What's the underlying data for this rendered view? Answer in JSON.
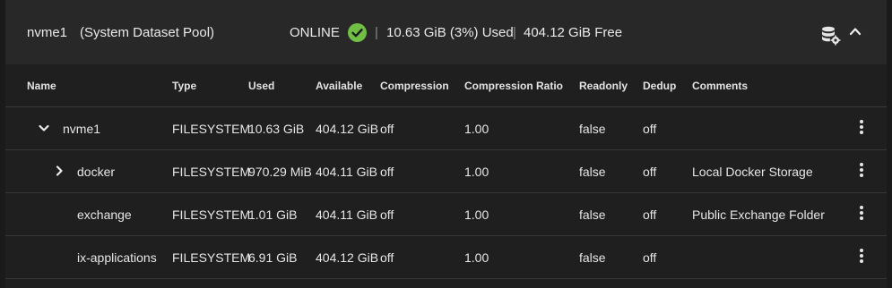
{
  "pool": {
    "name": "nvme1",
    "role": "(System Dataset Pool)",
    "status": "ONLINE",
    "used": "10.63 GiB (3%) Used",
    "free": "404.12 GiB Free",
    "separator": "|"
  },
  "icons": {
    "status": "check-circle-icon",
    "dataset_actions": "database-gear-icon",
    "collapse": "chevron-up-icon",
    "expanded": "chevron-down-icon",
    "collapsed": "chevron-right-icon",
    "row_menu": "more-vertical-icon"
  },
  "colors": {
    "status_ok": "#71bf44"
  },
  "columns": [
    "Name",
    "Type",
    "Used",
    "Available",
    "Compression",
    "Compression Ratio",
    "Readonly",
    "Dedup",
    "Comments"
  ],
  "rows": [
    {
      "name": "nvme1",
      "type": "FILESYSTEM",
      "used": "10.63 GiB",
      "available": "404.12 GiB",
      "compression": "off",
      "ratio": "1.00",
      "readonly": "false",
      "dedup": "off",
      "comments": "",
      "toggle": "expanded"
    },
    {
      "name": "docker",
      "type": "FILESYSTEM",
      "used": "970.29 MiB",
      "available": "404.11 GiB",
      "compression": "off",
      "ratio": "1.00",
      "readonly": "false",
      "dedup": "off",
      "comments": "Local Docker Storage",
      "toggle": "collapsed"
    },
    {
      "name": "exchange",
      "type": "FILESYSTEM",
      "used": "1.01 GiB",
      "available": "404.11 GiB",
      "compression": "off",
      "ratio": "1.00",
      "readonly": "false",
      "dedup": "off",
      "comments": "Public Exchange Folder",
      "toggle": "none"
    },
    {
      "name": "ix-applications",
      "type": "FILESYSTEM",
      "used": "6.91 GiB",
      "available": "404.12 GiB",
      "compression": "off",
      "ratio": "1.00",
      "readonly": "false",
      "dedup": "off",
      "comments": "",
      "toggle": "none"
    }
  ]
}
